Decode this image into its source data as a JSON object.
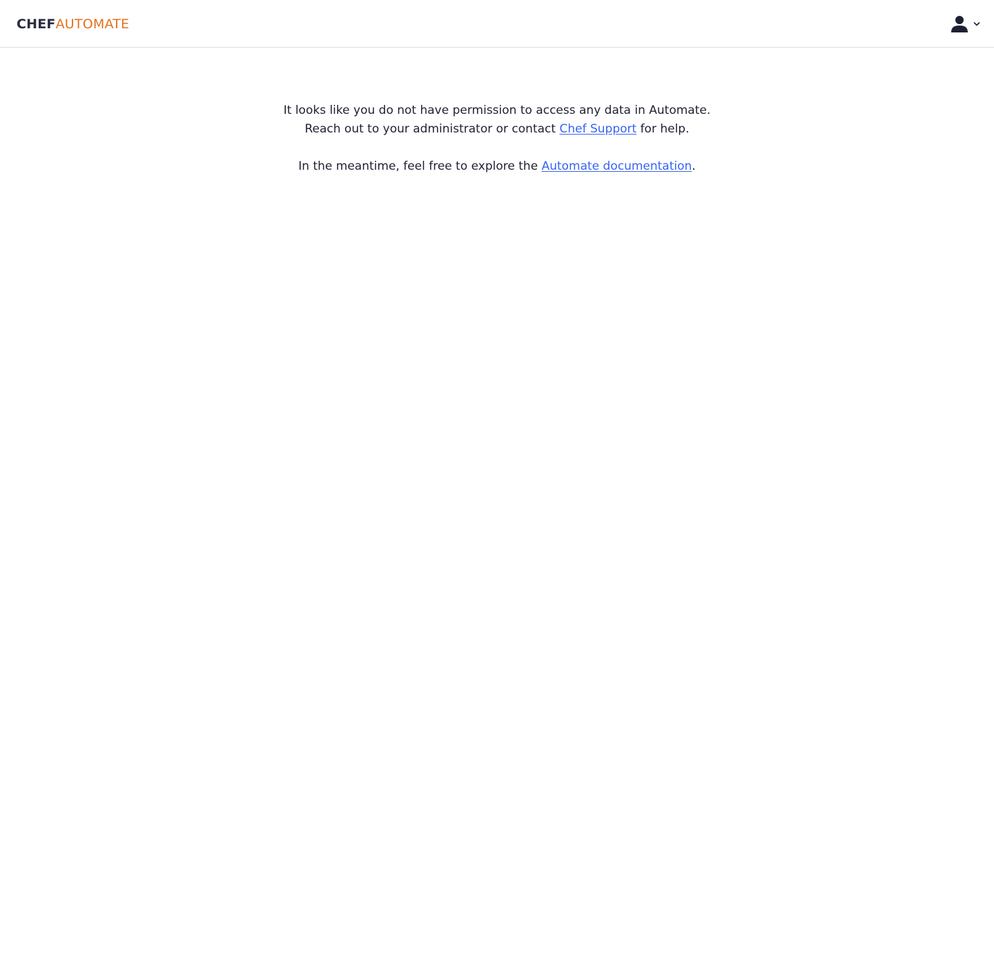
{
  "header": {
    "logo_chef": "CHEF",
    "logo_automate": "AUTOMATE",
    "colors": {
      "logo_chef": "#2a2d3f",
      "logo_automate": "#e4701e",
      "border": "#dcdde3"
    },
    "user_menu": {
      "icon": "user-icon",
      "dropdown_icon": "chevron-down-icon"
    }
  },
  "message": {
    "line1": "It looks like you do not have permission to access any data in Automate.",
    "line2_prefix": "Reach out to your administrator or contact ",
    "support_link": "Chef Support",
    "line2_suffix": " for help.",
    "line3_prefix": "In the meantime, feel free to explore the ",
    "docs_link": "Automate documentation",
    "line3_suffix": ".",
    "colors": {
      "text": "#1f2133",
      "link": "#3864f2"
    }
  }
}
